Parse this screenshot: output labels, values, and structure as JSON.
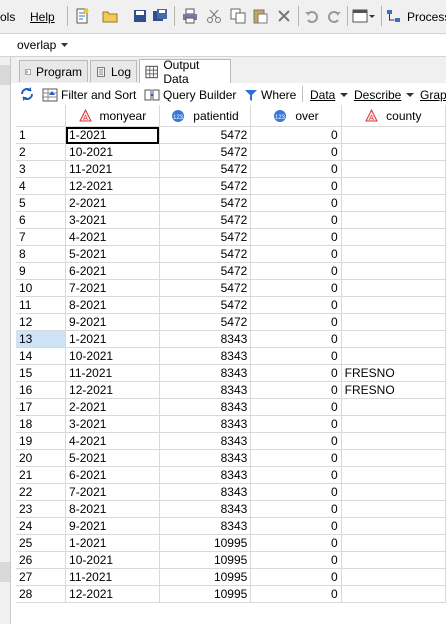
{
  "menu": {
    "tools_partial": "ols",
    "help": "Help",
    "process_flow": "Process"
  },
  "project": {
    "name": "overlap"
  },
  "tabs": [
    {
      "label": "Program"
    },
    {
      "label": "Log"
    },
    {
      "label": "Output Data"
    }
  ],
  "data_toolbar": {
    "filter_sort": "Filter and Sort",
    "query_builder": "Query Builder",
    "where": "Where",
    "data": "Data",
    "describe": "Describe",
    "graph_partial": "Graph"
  },
  "columns": [
    {
      "name": "monyear",
      "type": "character"
    },
    {
      "name": "patientid",
      "type": "numeric"
    },
    {
      "name": "over",
      "type": "numeric"
    },
    {
      "name": "county",
      "type": "character"
    }
  ],
  "rows": [
    [
      "1",
      "1-2021",
      "5472",
      "0",
      ""
    ],
    [
      "2",
      "10-2021",
      "5472",
      "0",
      ""
    ],
    [
      "3",
      "11-2021",
      "5472",
      "0",
      ""
    ],
    [
      "4",
      "12-2021",
      "5472",
      "0",
      ""
    ],
    [
      "5",
      "2-2021",
      "5472",
      "0",
      ""
    ],
    [
      "6",
      "3-2021",
      "5472",
      "0",
      ""
    ],
    [
      "7",
      "4-2021",
      "5472",
      "0",
      ""
    ],
    [
      "8",
      "5-2021",
      "5472",
      "0",
      ""
    ],
    [
      "9",
      "6-2021",
      "5472",
      "0",
      ""
    ],
    [
      "10",
      "7-2021",
      "5472",
      "0",
      ""
    ],
    [
      "11",
      "8-2021",
      "5472",
      "0",
      ""
    ],
    [
      "12",
      "9-2021",
      "5472",
      "0",
      ""
    ],
    [
      "13",
      "1-2021",
      "8343",
      "0",
      ""
    ],
    [
      "14",
      "10-2021",
      "8343",
      "0",
      ""
    ],
    [
      "15",
      "11-2021",
      "8343",
      "0",
      "FRESNO"
    ],
    [
      "16",
      "12-2021",
      "8343",
      "0",
      "FRESNO"
    ],
    [
      "17",
      "2-2021",
      "8343",
      "0",
      ""
    ],
    [
      "18",
      "3-2021",
      "8343",
      "0",
      ""
    ],
    [
      "19",
      "4-2021",
      "8343",
      "0",
      ""
    ],
    [
      "20",
      "5-2021",
      "8343",
      "0",
      ""
    ],
    [
      "21",
      "6-2021",
      "8343",
      "0",
      ""
    ],
    [
      "22",
      "7-2021",
      "8343",
      "0",
      ""
    ],
    [
      "23",
      "8-2021",
      "8343",
      "0",
      ""
    ],
    [
      "24",
      "9-2021",
      "8343",
      "0",
      ""
    ],
    [
      "25",
      "1-2021",
      "10995",
      "0",
      ""
    ],
    [
      "26",
      "10-2021",
      "10995",
      "0",
      ""
    ],
    [
      "27",
      "11-2021",
      "10995",
      "0",
      ""
    ],
    [
      "28",
      "12-2021",
      "10995",
      "0",
      ""
    ]
  ],
  "selected_row": "13",
  "colors": {
    "accent": "#1f5fbf",
    "selected_row_bg": "#cfe3f7",
    "grid_line": "#d9d9d9"
  }
}
